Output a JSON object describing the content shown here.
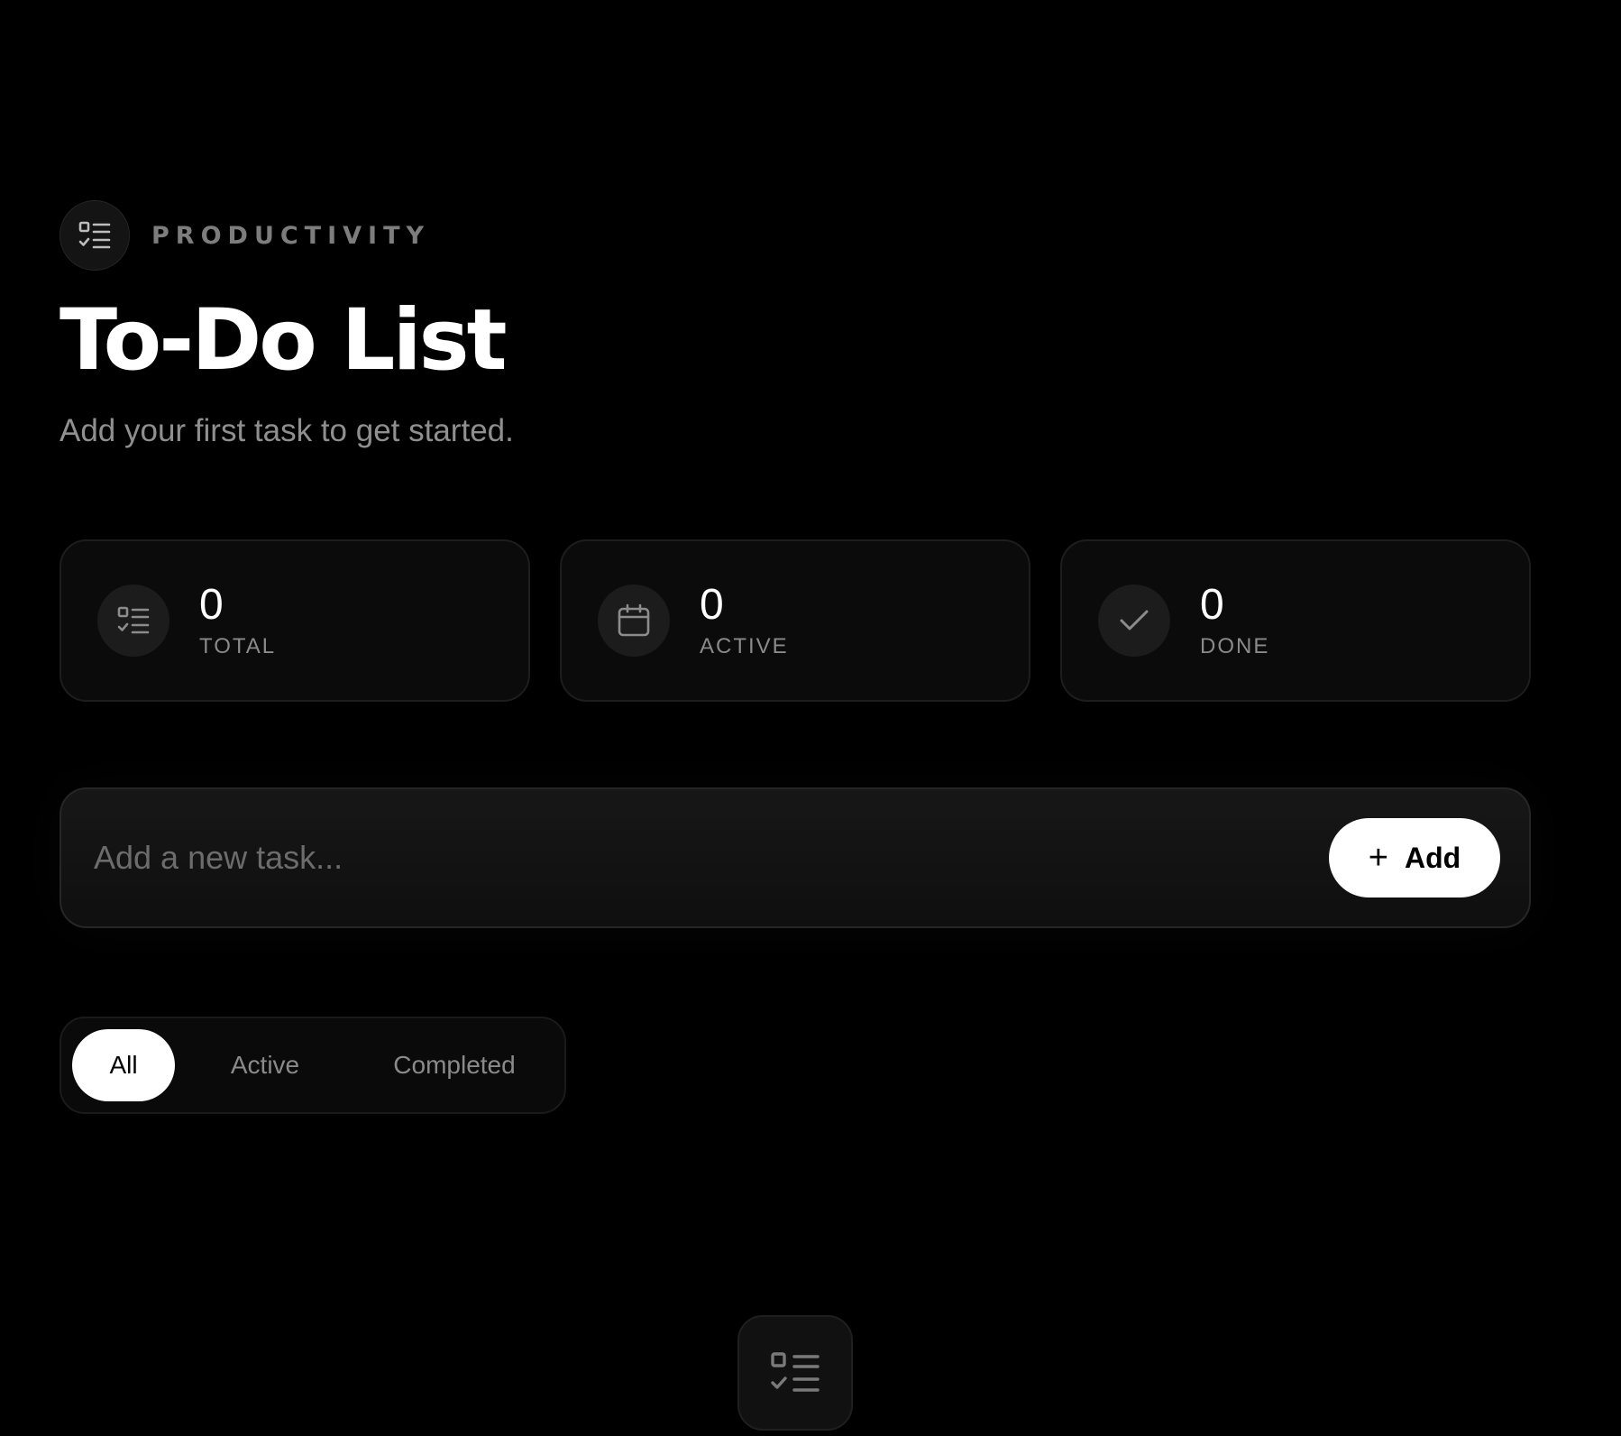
{
  "header": {
    "eyebrow_icon": "checklist-icon",
    "eyebrow": "PRODUCTIVITY",
    "title": "To-Do List",
    "subtitle": "Add your first task to get started."
  },
  "stats": [
    {
      "icon": "checklist-icon",
      "value": "0",
      "label": "TOTAL"
    },
    {
      "icon": "calendar-icon",
      "value": "0",
      "label": "ACTIVE"
    },
    {
      "icon": "checkmark-icon",
      "value": "0",
      "label": "DONE"
    }
  ],
  "task_input": {
    "placeholder": "Add a new task...",
    "value": ""
  },
  "add_button": {
    "icon": "plus-icon",
    "plus": "+",
    "label": "Add"
  },
  "filters": {
    "selected": "All",
    "tabs": [
      "All",
      "Active",
      "Completed"
    ]
  },
  "empty_state": {
    "icon": "checklist-icon"
  },
  "colors": {
    "background": "#000000",
    "card": "#0b0b0b",
    "accent": "#ffffff",
    "muted_text": "#8a8a8a"
  }
}
